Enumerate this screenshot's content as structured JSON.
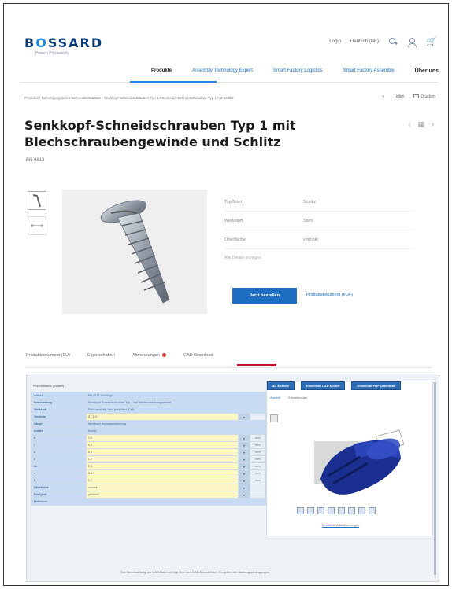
{
  "header": {
    "brand": "BOSSARD",
    "tagline": "Proven Productivity",
    "utility": [
      "Login",
      "Deutsch (DE)"
    ],
    "icons": [
      "search-icon",
      "user-icon",
      "cart-icon"
    ]
  },
  "nav": {
    "items": [
      {
        "label": "Produkte"
      },
      {
        "label": "Assembly Technology Expert"
      },
      {
        "label": "Smart Factory Logistics"
      },
      {
        "label": "Smart Factory Assembly"
      },
      {
        "label": "Über uns"
      }
    ],
    "active_index": 1
  },
  "breadcrumb": "Produkte / Befestigungsteile / Schneidschrauben / Senkkopf-Schneidschrauben Typ 1 / Senkkopf-Schneidschrauben Typ 1 mit Schlitz",
  "share": [
    "Teilen",
    "Drucken"
  ],
  "product": {
    "title": "Senkkopf-Schneidschrauben Typ 1 mit Blechschraubengewinde und Schlitz",
    "sku": "BN 9813",
    "specs": [
      {
        "label": "Typ/Norm",
        "value": "Schlitz"
      },
      {
        "label": "Werkstoff",
        "value": "Stahl"
      },
      {
        "label": "Oberfläche",
        "value": "verzinkt"
      }
    ],
    "note": "Alle Details anzeigen",
    "primary_button": "Jetzt bestellen",
    "secondary_link": "Produktdokument (PDF)"
  },
  "tabs": [
    {
      "label": "Produktdokument (EU)"
    },
    {
      "label": "Eigenschaften"
    },
    {
      "label": "Abmessungen",
      "badge": true
    },
    {
      "label": "CAD Download"
    }
  ],
  "cad": {
    "header": "Produktdaten (Modell)",
    "rows": [
      {
        "key": "Artikel",
        "value": "BN 9813 Senkkopf"
      },
      {
        "key": "Beschreibung",
        "value": "Senkkopf-Schneidschraube Typ 1 mit Blechschraubengewinde"
      },
      {
        "key": "Werkstoff",
        "value": "Stahl verzinkt, blau passiviert (Cr3)"
      },
      {
        "key": "Gewinde",
        "input": "ST 2,9",
        "select": true
      },
      {
        "key": "Länge",
        "value": "Senkkopf Normalausführung"
      },
      {
        "key": "Antrieb",
        "value": "Schlitz"
      },
      {
        "key": "d",
        "input": "2,9",
        "select": true,
        "unit": "mm"
      },
      {
        "key": "l",
        "input": "9,5",
        "select": true,
        "unit": "mm"
      },
      {
        "key": "b",
        "input": "6,8",
        "select": true,
        "unit": "mm"
      },
      {
        "key": "k",
        "input": "1,7",
        "select": true,
        "unit": "mm"
      },
      {
        "key": "dk",
        "input": "5,5",
        "select": true,
        "unit": "mm"
      },
      {
        "key": "n",
        "input": "0,8",
        "select": true,
        "unit": "mm"
      },
      {
        "key": "t",
        "input": "0,7",
        "select": true,
        "unit": "mm"
      },
      {
        "key": "Oberfläche",
        "input": "verzinkt",
        "select": true
      },
      {
        "key": "Festigkeit",
        "input": "gehärtet",
        "select": true
      },
      {
        "key": "Lieferform",
        "value": ""
      }
    ],
    "viewer_buttons": [
      "3D Ansicht",
      "Download CAD Modell",
      "Download PDF Datenblatt"
    ],
    "viewer_tabs": [
      "Ansicht",
      "Einstellungen"
    ],
    "viewer_link": "Modell in Vollbild anzeigen",
    "footer": "Die Bereitstellung der CAD-Daten erfolgt über den CAD-Dienstleister. Es gelten die Nutzungsbedingungen."
  },
  "colors": {
    "brand": "#0b3d78",
    "accent": "#1e6fc2",
    "tab_underline": "#c8102e",
    "badge": "#e53935"
  }
}
